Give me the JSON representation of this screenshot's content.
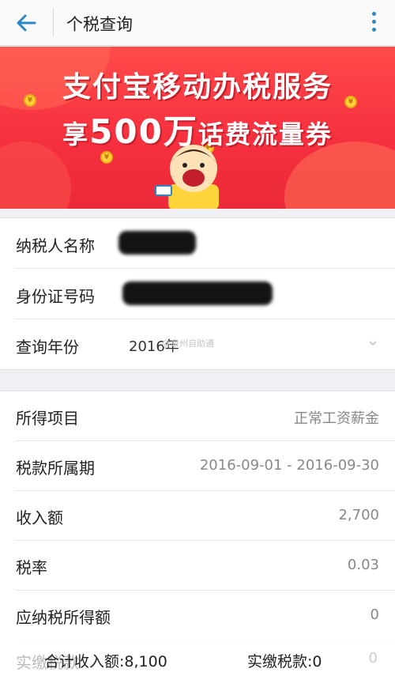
{
  "header": {
    "title": "个税查询"
  },
  "banner": {
    "line1": "支付宝移动办税服务",
    "line2_prefix": "享",
    "line2_amount": "500万",
    "line2_suffix": "话费流量券"
  },
  "taxpayer": {
    "name_label": "纳税人名称",
    "name_value": "*",
    "id_label": "身份证号码",
    "id_value": "",
    "year_label": "查询年份",
    "year_value": "2016年",
    "watermark": "@泉州自助通"
  },
  "details": [
    {
      "label": "所得项目",
      "value": "正常工资薪金"
    },
    {
      "label": "税款所属期",
      "value": "2016-09-01 - 2016-09-30"
    },
    {
      "label": "收入额",
      "value": "2,700"
    },
    {
      "label": "税率",
      "value": "0.03"
    },
    {
      "label": "应纳税所得额",
      "value": "0"
    }
  ],
  "summary": {
    "obscured_label": "实缴税款",
    "obscured_value": "0",
    "total_income": "合计收入额:8,100",
    "total_tax": "实缴税款:0"
  },
  "colors": {
    "accent": "#2a87c8",
    "banner_red": "#f52f3e"
  }
}
